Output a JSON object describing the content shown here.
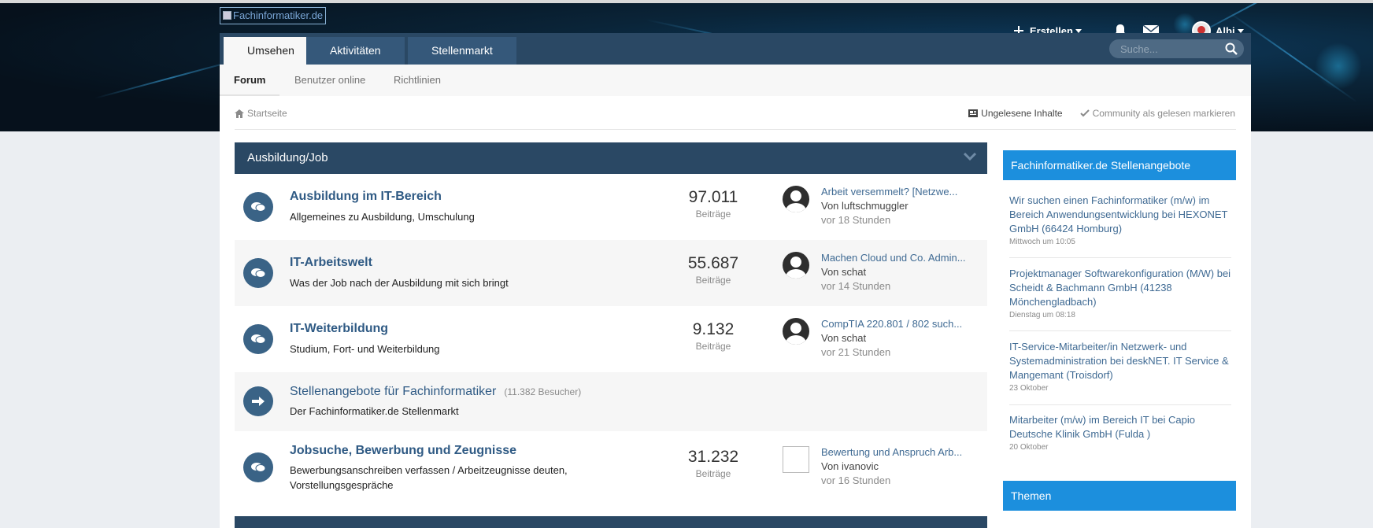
{
  "header": {
    "logo_alt": "Fachinformatiker.de",
    "create_label": "Erstellen",
    "user_name": "Albi"
  },
  "nav": {
    "tabs": [
      "Umsehen",
      "Aktivitäten",
      "Stellenmarkt"
    ],
    "search_placeholder": "Suche...",
    "subtabs": [
      "Forum",
      "Benutzer online",
      "Richtlinien"
    ]
  },
  "breadcrumb": {
    "home": "Startseite",
    "unread": "Ungelesene Inhalte",
    "mark_read": "Community als gelesen markieren"
  },
  "category": {
    "title": "Ausbildung/Job",
    "forums": [
      {
        "title": "Ausbildung im IT-Bereich",
        "desc": "Allgemeines zu Ausbildung, Umschulung",
        "posts": "97.011",
        "posts_label": "Beiträge",
        "last_title": "Arbeit versemmelt? [Netzwe...",
        "last_by": "Von luftschmuggler",
        "last_when": "vor 18 Stunden"
      },
      {
        "title": "IT-Arbeitswelt",
        "desc": "Was der Job nach der Ausbildung mit sich bringt",
        "posts": "55.687",
        "posts_label": "Beiträge",
        "last_title": "Machen Cloud und Co. Admin...",
        "last_by": "Von schat",
        "last_when": "vor 14 Stunden"
      },
      {
        "title": "IT-Weiterbildung",
        "desc": "Studium, Fort- und Weiterbildung",
        "posts": "9.132",
        "posts_label": "Beiträge",
        "last_title": "CompTIA 220.801 / 802 such...",
        "last_by": "Von schat",
        "last_when": "vor 21 Stunden"
      },
      {
        "title": "Stellenangebote für Fachinformatiker",
        "visitors": "(11.382 Besucher)",
        "desc": "Der Fachinformatiker.de Stellenmarkt"
      },
      {
        "title": "Jobsuche, Bewerbung und Zeugnisse",
        "desc": "Bewerbungsanschreiben verfassen / Arbeitzeugnisse deuten, Vorstellungsgespräche",
        "posts": "31.232",
        "posts_label": "Beiträge",
        "last_title": "Bewertung und Anspruch Arb...",
        "last_by": "Von ivanovic",
        "last_when": "vor 16 Stunden"
      }
    ]
  },
  "sidebar": {
    "jobs_title": "Fachinformatiker.de Stellenangebote",
    "jobs": [
      {
        "title": "Wir suchen einen Fachinformatiker (m/w) im Bereich Anwendungsentwicklung bei HEXONET GmbH (66424 Homburg)",
        "date": "Mittwoch um 10:05"
      },
      {
        "title": "Projektmanager Softwarekonfiguration (M/W) bei Scheidt & Bachmann GmbH (41238 Mönchengladbach)",
        "date": "Dienstag um 08:18"
      },
      {
        "title": "IT-Service-Mitarbeiter/in Netzwerk- und Systemadministration bei deskNET. IT Service & Mangemant (Troisdorf)",
        "date": "23 Oktober"
      },
      {
        "title": "Mitarbeiter (m/w) im Bereich IT bei Capio Deutsche Klinik GmbH (Fulda )",
        "date": "20 Oktober"
      }
    ],
    "topics_title": "Themen"
  },
  "colors": {
    "navbar": "#2a4864",
    "accent_blue": "#1c8fdd",
    "link": "#2f5a84",
    "forum_icon": "#3a6386"
  }
}
